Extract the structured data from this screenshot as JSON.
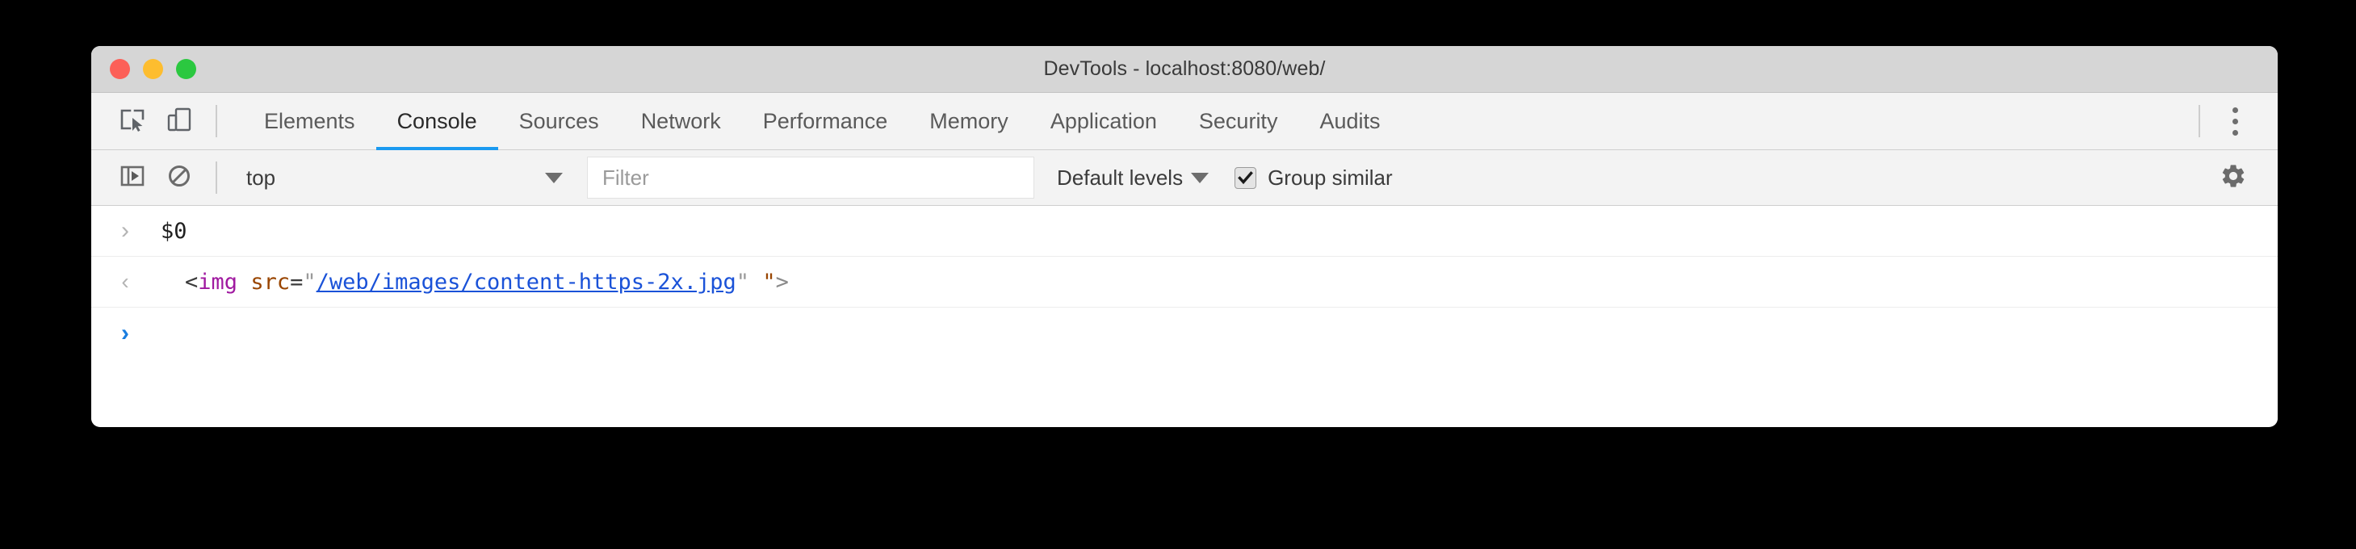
{
  "window": {
    "title": "DevTools - localhost:8080/web/",
    "traffic_lights": [
      {
        "name": "close",
        "color": "#fc6058"
      },
      {
        "name": "minimize",
        "color": "#fdbd2f"
      },
      {
        "name": "zoom",
        "color": "#2bc840"
      }
    ]
  },
  "tabbar": {
    "inspect_icon": "inspect-element-icon",
    "device_icon": "device-toolbar-icon",
    "more_icon": "more-options-kebab-icon",
    "tabs": [
      {
        "label": "Elements",
        "active": false
      },
      {
        "label": "Console",
        "active": true
      },
      {
        "label": "Sources",
        "active": false
      },
      {
        "label": "Network",
        "active": false
      },
      {
        "label": "Performance",
        "active": false
      },
      {
        "label": "Memory",
        "active": false
      },
      {
        "label": "Application",
        "active": false
      },
      {
        "label": "Security",
        "active": false
      },
      {
        "label": "Audits",
        "active": false
      }
    ],
    "active_underline_color": "#1a9af0"
  },
  "console_toolbar": {
    "sidebar_toggle_icon": "console-sidebar-toggle-icon",
    "clear_icon": "clear-console-icon",
    "context_selected": "top",
    "context_caret_icon": "chevron-down-icon",
    "filter_placeholder": "Filter",
    "filter_value": "",
    "levels_label": "Default levels",
    "levels_caret_icon": "chevron-down-icon",
    "group_similar_label": "Group similar",
    "group_similar_checked": true,
    "settings_icon": "gear-icon"
  },
  "console_output": {
    "lines": [
      {
        "type": "input",
        "prompt_icon": "prompt-chevron-icon",
        "text": "$0"
      },
      {
        "type": "result",
        "prompt_icon": "result-arrow-icon",
        "tokens": [
          {
            "kind": "punct",
            "text": "<"
          },
          {
            "kind": "tag",
            "text": "img"
          },
          {
            "kind": "punct",
            "text": " "
          },
          {
            "kind": "attr",
            "text": "src"
          },
          {
            "kind": "punct",
            "text": "="
          },
          {
            "kind": "quote",
            "text": "\""
          },
          {
            "kind": "link",
            "text": "/web/images/content-https-2x.jpg"
          },
          {
            "kind": "quote",
            "text": "\""
          },
          {
            "kind": "punct",
            "text": " "
          },
          {
            "kind": "quote-orange",
            "text": "\""
          },
          {
            "kind": "gt",
            "text": ">"
          }
        ],
        "plain_text": "<img src=\"/web/images/content-https-2x.jpg\" \">"
      },
      {
        "type": "prompt",
        "prompt_icon": "active-prompt-chevron-icon",
        "text": ""
      }
    ]
  }
}
